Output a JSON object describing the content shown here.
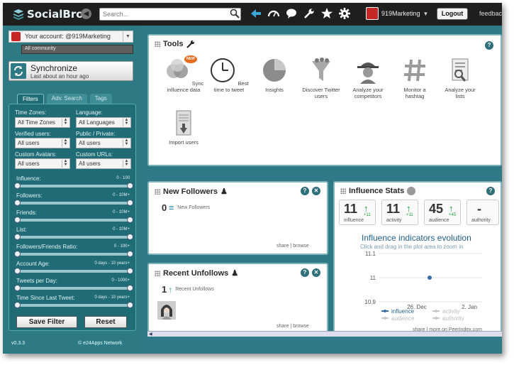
{
  "app": {
    "name": "SocialBro"
  },
  "topbar": {
    "search_placeholder": "Search...",
    "account_name": "919Marketing",
    "logout_label": "Logout",
    "feedback_label": "feedbac",
    "icons": [
      "back-arrow-icon",
      "dashboard-icon",
      "speech-bubble-icon",
      "wrench-icon",
      "star-icon",
      "gear-icon"
    ]
  },
  "sidebar": {
    "account_label": "Your account: @919Marketing",
    "community_label": "All community",
    "sync_title": "Synchronize",
    "sync_subtitle": "Last about an hour ago",
    "tabs": [
      "Filters",
      "Adv. Search",
      "Tags"
    ],
    "filters": {
      "time_zones_label": "Time Zones:",
      "time_zones_value": "All Time Zones",
      "language_label": "Language:",
      "language_value": "All Languages",
      "verified_label": "Verified users:",
      "verified_value": "All users",
      "public_label": "Public / Private:",
      "public_value": "All users",
      "avatars_label": "Custom Avatars:",
      "avatars_value": "All users",
      "urls_label": "Custom URLs:",
      "urls_value": "All users"
    },
    "ranges": [
      {
        "label": "Influence:",
        "range": "0 - 100"
      },
      {
        "label": "Followers:",
        "range": "0 - 10M+"
      },
      {
        "label": "Friends:",
        "range": "0 - 10M+"
      },
      {
        "label": "List:",
        "range": "0 - 10M+"
      },
      {
        "label": "Followers/Friends Ratio:",
        "range": "0 - 100+"
      },
      {
        "label": "Account Age:",
        "range": "0 days - 10 years+"
      },
      {
        "label": "Tweets per Day:",
        "range": "0 - 1000+"
      },
      {
        "label": "Time Since Last Tweet:",
        "range": "0 days - 10 years+"
      }
    ],
    "save_filter_label": "Save Filter",
    "reset_label": "Reset",
    "version": "v0.3.3",
    "network": "© e24Apps Network"
  },
  "tools": {
    "title": "Tools",
    "new_badge": "NEW",
    "items": [
      {
        "label": "Sync influence data",
        "icon": "venn-circles-icon"
      },
      {
        "label": "Best time to tweet",
        "icon": "clock-icon"
      },
      {
        "label": "Insights",
        "icon": "pie-chart-icon"
      },
      {
        "label": "Discover Twitter users",
        "icon": "funnel-icon"
      },
      {
        "label": "Analyze your competitors",
        "icon": "spy-icon"
      },
      {
        "label": "Monitor a hashtag",
        "icon": "hashtag-icon"
      },
      {
        "label": "Analyze your lists",
        "icon": "list-magnifier-icon"
      },
      {
        "label": "Import users",
        "icon": "import-document-icon"
      }
    ]
  },
  "new_followers": {
    "title": "New Followers",
    "count": "0",
    "label": "New Followers",
    "share": "share",
    "browse": "| browse"
  },
  "recent_unfollows": {
    "title": "Recent Unfollows",
    "count": "1",
    "label": "Recent Unfollows",
    "share": "share",
    "browse": "| browse"
  },
  "influence_stats": {
    "title": "Influence Stats",
    "stats": [
      {
        "value": "11",
        "delta": "+11",
        "label": "influence",
        "trend": "up"
      },
      {
        "value": "11",
        "delta": "+11",
        "label": "activity",
        "trend": "up"
      },
      {
        "value": "45",
        "delta": "+45",
        "label": "audience",
        "trend": "up"
      },
      {
        "value": "-",
        "delta": "",
        "label": "authority",
        "trend": "none"
      }
    ],
    "chart_title": "Influence indicators evolution",
    "chart_subtitle": "Click and drag in the plot area to zoom in",
    "legend": [
      "influence",
      "activity",
      "audience",
      "authority"
    ],
    "share": "share",
    "more": "| more on PeerIndex.com"
  },
  "chart_data": {
    "type": "line",
    "title": "Influence indicators evolution",
    "y_ticks": [
      "11.1",
      "11",
      "10.9"
    ],
    "x_ticks": [
      "26. Dec",
      "2. Jan"
    ],
    "ylim": [
      10.9,
      11.1
    ],
    "series": [
      {
        "name": "influence",
        "points": [
          {
            "x": "27. Dec",
            "y": 11
          }
        ]
      }
    ],
    "grid": true,
    "legend_position": "bottom"
  }
}
